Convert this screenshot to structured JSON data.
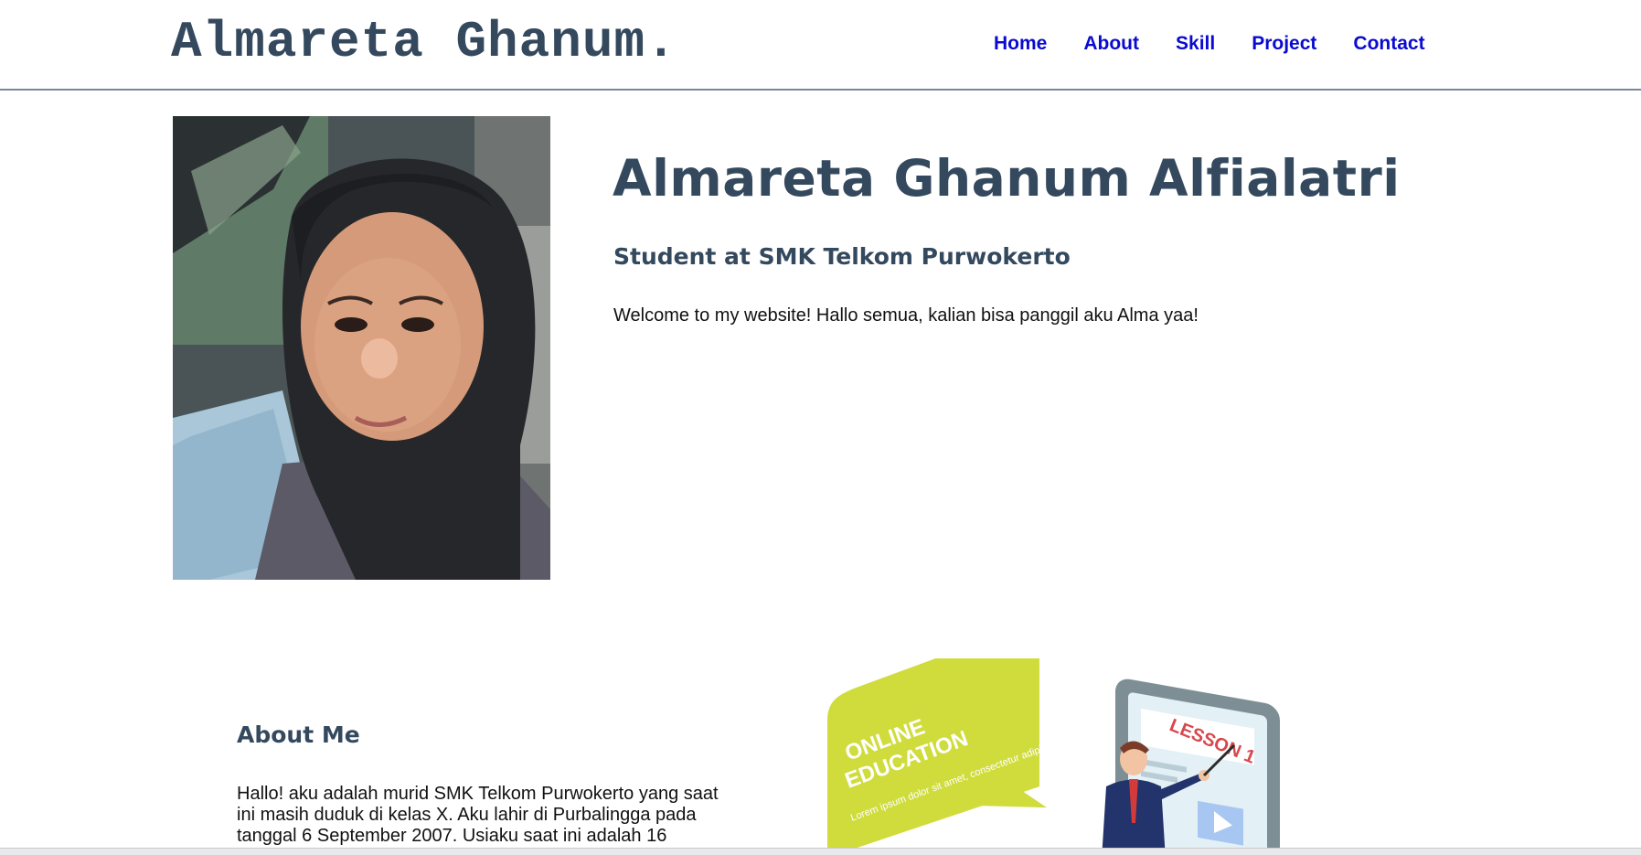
{
  "header": {
    "brand": "Almareta Ghanum.",
    "nav": [
      "Home",
      "About",
      "Skill",
      "Project",
      "Contact"
    ]
  },
  "hero": {
    "photo_alt": "profile-photo",
    "name": "Almareta Ghanum Alfialatri",
    "subtitle": "Student at SMK Telkom Purwokerto",
    "welcome": "Welcome to my website! Hallo semua, kalian bisa panggil aku Alma yaa!"
  },
  "about": {
    "title": "About Me",
    "text": "Hallo! aku adalah murid SMK Telkom Purwokerto yang saat ini masih duduk di kelas X. Aku lahir di Purbalingga pada tanggal 6 September 2007. Usiaku saat ini adalah 16"
  },
  "illustration": {
    "bubble_title": "ONLINE EDUCATION",
    "bubble_body": "Lorem ipsum dolor sit amet, consectetur adipiscing elit, sed do eiusmod tempor incididunt ut labore magna,",
    "board_title": "LESSON 1"
  },
  "colors": {
    "heading": "#34495e",
    "nav_link": "#0a0ad0",
    "bubble": "#cfdc3c"
  }
}
